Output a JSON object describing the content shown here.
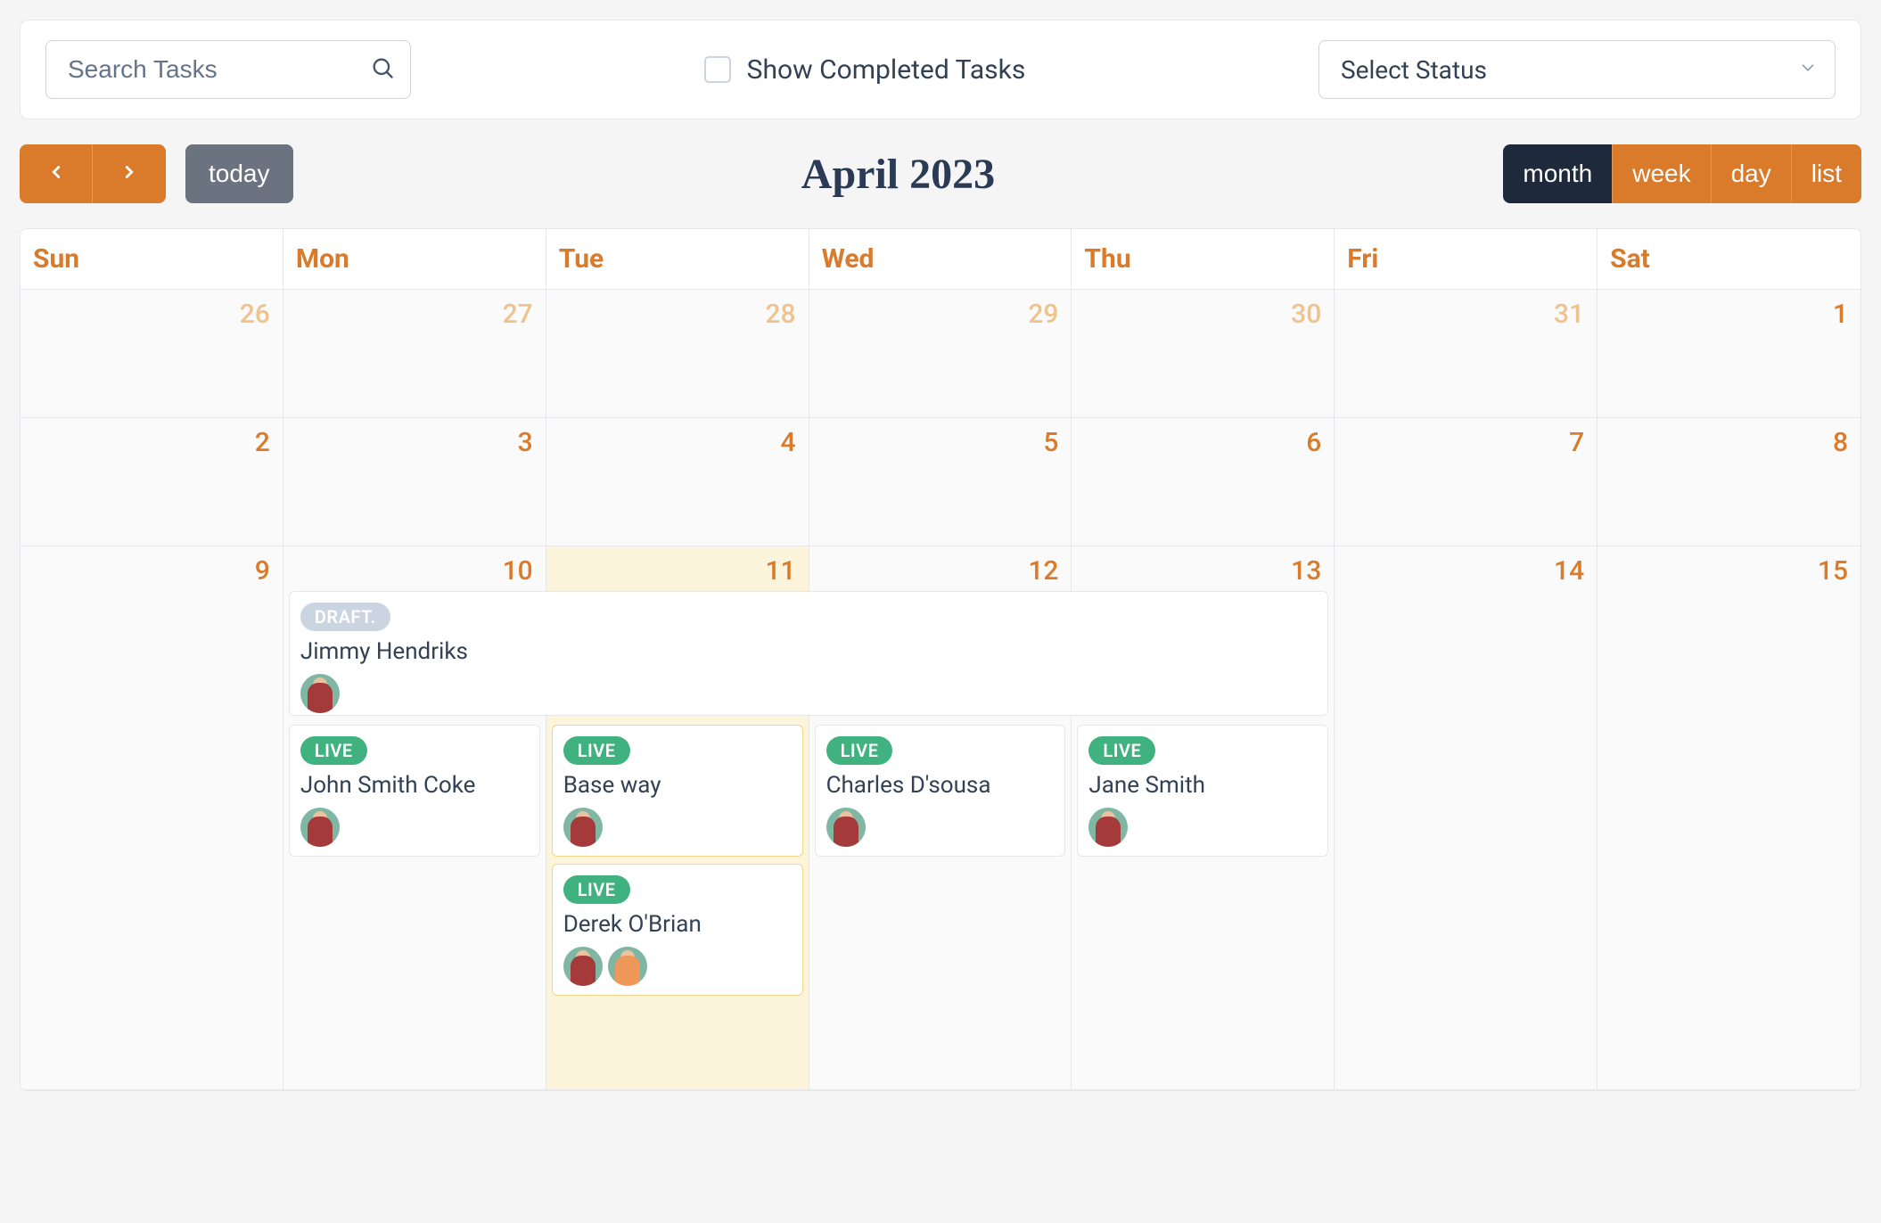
{
  "filters": {
    "search_placeholder": "Search Tasks",
    "show_completed_label": "Show Completed Tasks",
    "status_placeholder": "Select Status"
  },
  "toolbar": {
    "today_label": "today",
    "title": "April 2023",
    "views": {
      "month": "month",
      "week": "week",
      "day": "day",
      "list": "list"
    },
    "active_view": "month"
  },
  "day_headers": [
    "Sun",
    "Mon",
    "Tue",
    "Wed",
    "Thu",
    "Fri",
    "Sat"
  ],
  "weeks": [
    [
      {
        "n": "26",
        "other": true
      },
      {
        "n": "27",
        "other": true
      },
      {
        "n": "28",
        "other": true
      },
      {
        "n": "29",
        "other": true
      },
      {
        "n": "30",
        "other": true
      },
      {
        "n": "31",
        "other": true
      },
      {
        "n": "1"
      }
    ],
    [
      {
        "n": "2"
      },
      {
        "n": "3"
      },
      {
        "n": "4"
      },
      {
        "n": "5"
      },
      {
        "n": "6"
      },
      {
        "n": "7"
      },
      {
        "n": "8"
      }
    ],
    [
      {
        "n": "9"
      },
      {
        "n": "10"
      },
      {
        "n": "11",
        "today": true
      },
      {
        "n": "12"
      },
      {
        "n": "13"
      },
      {
        "n": "14"
      },
      {
        "n": "15"
      }
    ]
  ],
  "span_event": {
    "status": "DRAFT.",
    "title": "Jimmy Hendriks",
    "start_col": 1,
    "span_cols": 4,
    "avatars": [
      "red"
    ]
  },
  "column_events": {
    "1": [
      {
        "status": "LIVE",
        "title": "John Smith Coke",
        "avatars": [
          "red"
        ]
      }
    ],
    "2": [
      {
        "status": "LIVE",
        "title": "Base way",
        "avatars": [
          "red"
        ],
        "highlight": true
      },
      {
        "status": "LIVE",
        "title": "Derek O'Brian",
        "avatars": [
          "red",
          "orange"
        ],
        "highlight": true
      }
    ],
    "3": [
      {
        "status": "LIVE",
        "title": "Charles D'sousa",
        "avatars": [
          "red"
        ]
      }
    ],
    "4": [
      {
        "status": "LIVE",
        "title": "Jane Smith",
        "avatars": [
          "red"
        ]
      }
    ]
  }
}
